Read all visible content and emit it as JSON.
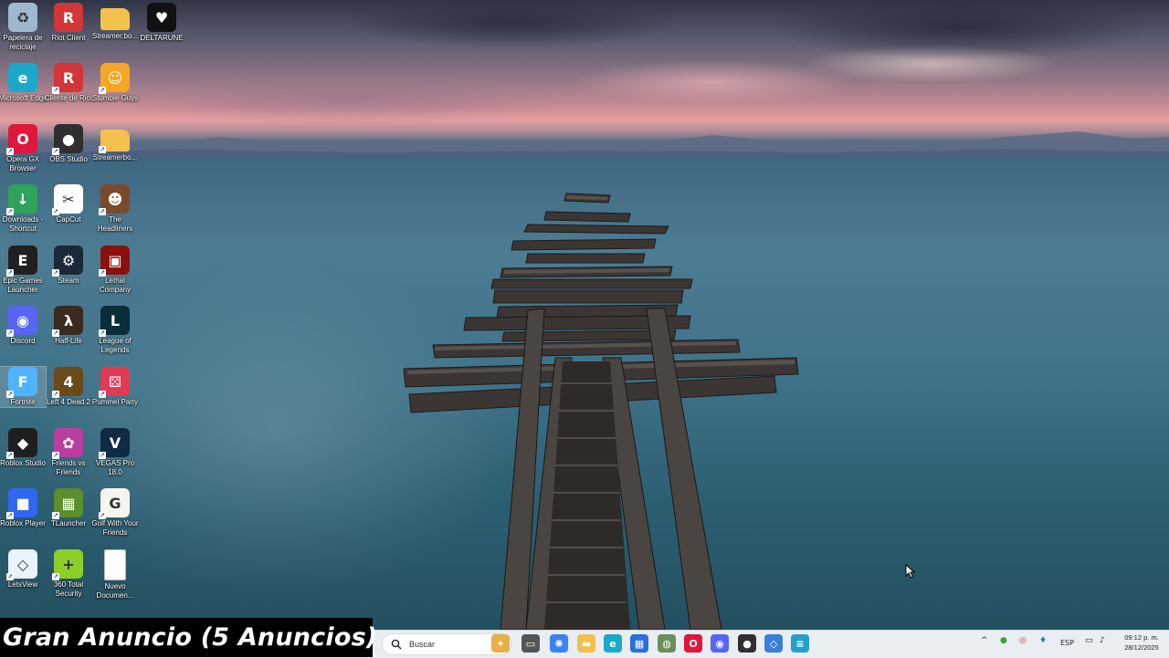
{
  "desktop_icons": [
    {
      "label": "Papelera de reciclaje",
      "icon": "recycle-bin-icon",
      "color": "#9fb7cf"
    },
    {
      "label": "Riot Client",
      "icon": "riot-client-icon",
      "color": "#d13639"
    },
    {
      "label": "Streamer.bo...",
      "icon": "folder-icon",
      "color": "#f2c14e"
    },
    {
      "label": "DELTARUNE",
      "icon": "deltarune-icon",
      "color": "#111111"
    },
    {
      "label": "Microsoft Edge",
      "icon": "edge-icon",
      "color": "#1ca9c9"
    },
    {
      "label": "Cliente de Riot",
      "icon": "riot-client-icon",
      "color": "#d13639"
    },
    {
      "label": "Stumble Guys",
      "icon": "stumble-guys-icon",
      "color": "#f5a623"
    },
    {
      "label": "Opera GX Browser",
      "icon": "opera-gx-icon",
      "color": "#e0163c"
    },
    {
      "label": "OBS Studio",
      "icon": "obs-icon",
      "color": "#302e31"
    },
    {
      "label": "Streamerbo...",
      "icon": "folder-icon",
      "color": "#f2c14e"
    },
    {
      "label": "Downloads - Shortcut",
      "icon": "downloads-folder-icon",
      "color": "#2fa35a"
    },
    {
      "label": "CapCut",
      "icon": "capcut-icon",
      "color": "#ffffff"
    },
    {
      "label": "The Headliners",
      "icon": "headliners-icon",
      "color": "#7a4a2f"
    },
    {
      "label": "Epic Games Launcher",
      "icon": "epic-games-icon",
      "color": "#202020"
    },
    {
      "label": "Steam",
      "icon": "steam-icon",
      "color": "#1b2838"
    },
    {
      "label": "Lethal Company",
      "icon": "lethal-company-icon",
      "color": "#8b1010"
    },
    {
      "label": "Discord",
      "icon": "discord-icon",
      "color": "#5865f2"
    },
    {
      "label": "Half-Life",
      "icon": "half-life-icon",
      "color": "#3b2a20"
    },
    {
      "label": "League of Legends",
      "icon": "league-icon",
      "color": "#0a2d3a"
    },
    {
      "label": "Fortnite",
      "icon": "fortnite-icon",
      "color": "#4fb3ff"
    },
    {
      "label": "Left 4 Dead 2",
      "icon": "left4dead-icon",
      "color": "#6b4a1a"
    },
    {
      "label": "Pummel Party",
      "icon": "pummel-party-icon",
      "color": "#e23a56"
    },
    {
      "label": "Roblox Studio",
      "icon": "roblox-studio-icon",
      "color": "#1f1f1f"
    },
    {
      "label": "Friends vs Friends",
      "icon": "friends-vs-friends-icon",
      "color": "#b93ea0"
    },
    {
      "label": "VEGAS Pro 18.0",
      "icon": "vegas-pro-icon",
      "color": "#102a44"
    },
    {
      "label": "Roblox Player",
      "icon": "roblox-player-icon",
      "color": "#3066f2"
    },
    {
      "label": "TLauncher",
      "icon": "tlauncher-icon",
      "color": "#5a8f2b"
    },
    {
      "label": "Golf With Your Friends",
      "icon": "golf-icon",
      "color": "#f6f6f0"
    },
    {
      "label": "LetsView",
      "icon": "letsview-icon",
      "color": "#e8f4ff"
    },
    {
      "label": "360 Total Security",
      "icon": "security-360-icon",
      "color": "#8ccf2a"
    },
    {
      "label": "Nuevo Documen...",
      "icon": "text-document-icon",
      "color": "#ffffff"
    }
  ],
  "icon_glyphs": {
    "recycle-bin-icon": "♻",
    "riot-client-icon": "R",
    "folder-icon": "",
    "deltarune-icon": "♥",
    "edge-icon": "e",
    "stumble-guys-icon": "☺",
    "opera-gx-icon": "O",
    "obs-icon": "●",
    "downloads-folder-icon": "↓",
    "capcut-icon": "✂",
    "headliners-icon": "☻",
    "epic-games-icon": "E",
    "steam-icon": "⚙",
    "lethal-company-icon": "▣",
    "discord-icon": "◉",
    "half-life-icon": "λ",
    "league-icon": "L",
    "fortnite-icon": "F",
    "left4dead-icon": "4",
    "pummel-party-icon": "⚄",
    "roblox-studio-icon": "◆",
    "friends-vs-friends-icon": "✿",
    "vegas-pro-icon": "V",
    "roblox-player-icon": "■",
    "tlauncher-icon": "▦",
    "golf-icon": "G",
    "letsview-icon": "◇",
    "security-360-icon": "+",
    "text-document-icon": ""
  },
  "overlay": {
    "banner_text": "Gran Anuncio (5 Anuncios)"
  },
  "taskbar": {
    "search_placeholder": "Buscar",
    "pinned": [
      {
        "icon": "widgets-icon",
        "color": "#e8b04a",
        "glyph": "✦"
      },
      {
        "icon": "task-view-icon",
        "color": "#555555",
        "glyph": "▭"
      },
      {
        "icon": "copilot-icon",
        "color": "#3b82f6",
        "glyph": "✺"
      },
      {
        "icon": "file-explorer-icon",
        "color": "#f2c14e",
        "glyph": "▬"
      },
      {
        "icon": "edge-icon",
        "color": "#1ca9c9",
        "glyph": "e"
      },
      {
        "icon": "store-icon",
        "color": "#2a6fdb",
        "glyph": "▦"
      },
      {
        "icon": "app-icon",
        "color": "#6b8e5a",
        "glyph": "◍"
      },
      {
        "icon": "opera-gx-icon",
        "color": "#e0163c",
        "glyph": "O"
      },
      {
        "icon": "discord-icon",
        "color": "#5865f2",
        "glyph": "◉"
      },
      {
        "icon": "obs-icon",
        "color": "#302e31",
        "glyph": "●"
      },
      {
        "icon": "letsview-icon",
        "color": "#3c7dd9",
        "glyph": "◇"
      },
      {
        "icon": "notepad-icon",
        "color": "#27a0c8",
        "glyph": "≡"
      }
    ],
    "tray": {
      "language": "ESP",
      "time": "09:12 p. m.",
      "date": "28/12/2025"
    }
  }
}
